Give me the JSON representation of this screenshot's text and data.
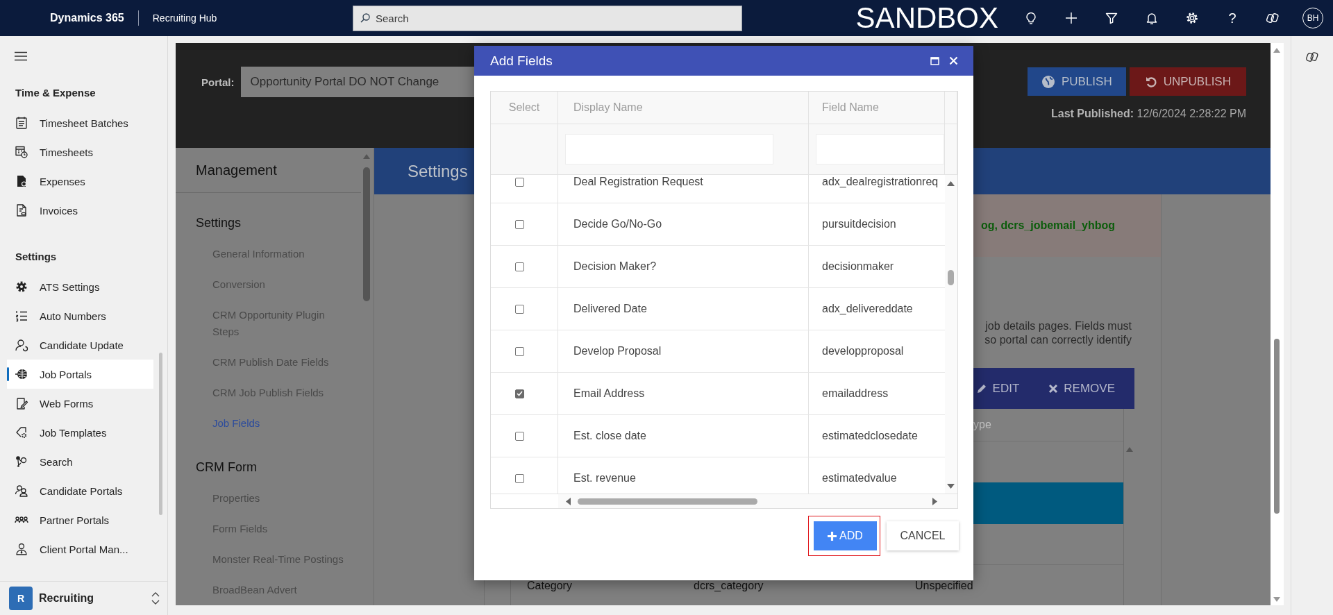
{
  "top_bar": {
    "app_name": "Dynamics 365",
    "area": "Recruiting Hub",
    "search": {
      "placeholder": "Search"
    },
    "environment": "SANDBOX",
    "help": "?",
    "avatar": "BH"
  },
  "sidebar": {
    "groups": [
      {
        "title": "Time & Expense",
        "items": [
          {
            "label": "Timesheet Batches",
            "selected": false
          },
          {
            "label": "Timesheets",
            "selected": false
          },
          {
            "label": "Expenses",
            "selected": false
          },
          {
            "label": "Invoices",
            "selected": false
          }
        ]
      },
      {
        "title": "Settings",
        "items": [
          {
            "label": "ATS Settings",
            "selected": false
          },
          {
            "label": "Auto Numbers",
            "selected": false
          },
          {
            "label": "Candidate Update",
            "selected": false
          },
          {
            "label": "Job Portals",
            "selected": true
          },
          {
            "label": "Web Forms",
            "selected": false
          },
          {
            "label": "Job Templates",
            "selected": false
          },
          {
            "label": "Search",
            "selected": false
          },
          {
            "label": "Candidate Portals",
            "selected": false
          },
          {
            "label": "Partner Portals",
            "selected": false
          },
          {
            "label": "Client Portal Man...",
            "selected": false
          }
        ]
      }
    ],
    "area_switcher": {
      "badge": "R",
      "label": "Recruiting"
    }
  },
  "portal_header": {
    "label": "Portal:",
    "value": "Opportunity Portal DO NOT Change",
    "actions": [
      {
        "label": "PUBLISH",
        "kind": "publish"
      },
      {
        "label": "UNPUBLISH",
        "kind": "unpublish"
      }
    ],
    "last_published_label": "Last Published:",
    "last_published": "12/6/2024 2:28:22 PM"
  },
  "management": {
    "title": "Management",
    "sections": [
      {
        "title": "Settings",
        "items": [
          {
            "label": "General Information",
            "selected": false
          },
          {
            "label": "Conversion",
            "selected": false
          },
          {
            "label": "CRM Opportunity Plugin Steps",
            "selected": false
          },
          {
            "label": "CRM Publish Date Fields",
            "selected": false
          },
          {
            "label": "CRM Job Publish Fields",
            "selected": false
          },
          {
            "label": "Job Fields",
            "selected": true
          }
        ]
      },
      {
        "title": "CRM Form",
        "items": [
          {
            "label": "Properties",
            "selected": false
          },
          {
            "label": "Form Fields",
            "selected": false
          },
          {
            "label": "Monster Real-Time Postings",
            "selected": false
          },
          {
            "label": "BroadBean Advert",
            "selected": false
          }
        ]
      }
    ]
  },
  "content": {
    "tab": "Settings",
    "notice": "og, dcrs_jobemail_yhbog",
    "description_lines": [
      "job details pages. Fields must",
      "so portal can correctly identify"
    ],
    "toolbar": [
      {
        "label": "EDIT",
        "kind": "edit"
      },
      {
        "label": "REMOVE",
        "kind": "remove"
      }
    ],
    "column_header": "ype",
    "row": [
      "Category",
      "dcrs_category",
      "Unspecified"
    ]
  },
  "dialog": {
    "title": "Add Fields",
    "columns": [
      "Select",
      "Display Name",
      "Field Name"
    ],
    "rows": [
      {
        "display_name": "Deal Registration Request",
        "field_name": "adx_dealregistrationreq",
        "checked": false
      },
      {
        "display_name": "Decide Go/No-Go",
        "field_name": "pursuitdecision",
        "checked": false
      },
      {
        "display_name": "Decision Maker?",
        "field_name": "decisionmaker",
        "checked": false
      },
      {
        "display_name": "Delivered Date",
        "field_name": "adx_delivereddate",
        "checked": false
      },
      {
        "display_name": "Develop Proposal",
        "field_name": "developproposal",
        "checked": false
      },
      {
        "display_name": "Email Address",
        "field_name": "emailaddress",
        "checked": true
      },
      {
        "display_name": "Est. close date",
        "field_name": "estimatedclosedate",
        "checked": false
      },
      {
        "display_name": "Est. revenue",
        "field_name": "estimatedvalue",
        "checked": false
      }
    ],
    "buttons": [
      {
        "label": "ADD",
        "kind": "primary",
        "highlighted": true
      },
      {
        "label": "CANCEL",
        "kind": "secondary",
        "highlighted": false
      }
    ]
  }
}
